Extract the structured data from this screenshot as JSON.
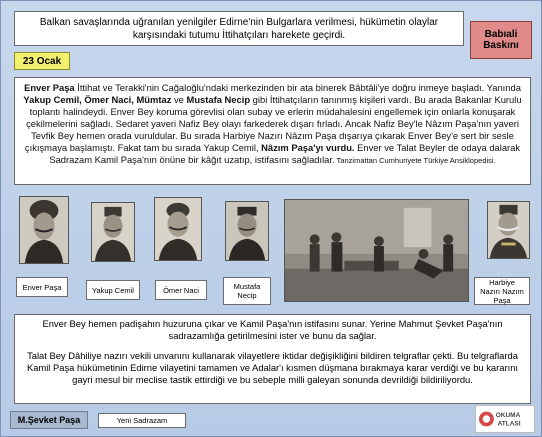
{
  "intro_text": "Balkan savaşlarında uğranılan yenilgiler Edirne'nin Bulgarlara verilmesi, hükümetin olaylar karşısındaki tutumu İttihatçıları harekete geçirdi.",
  "side_button": "Babıali Baskını",
  "date_label": "23 Ocak",
  "story": {
    "s1_bold": "Enver Paşa",
    "s1_a": " İttihat ve Terakki'nin Cağaloğlu'ndaki merkezinden bir ata binerek Bâbtâli'ye doğru inmeye başladı. Yanında ",
    "s1_names": "Yakup Cemil, Ömer Naci, Mümtaz",
    "s1_ve": " ve ",
    "s1_mustafa": "Mustafa Necip",
    "s1_b": " gibi İttihatçıların tanınmış kişileri vardı. Bu arada Bakanlar Kurulu toplantı halindeydi. Enver Bey koruma görevlisi olan subay ve erlerin müdahalesini engellemek için onlarla konuşarak çekilmelerini sağladı. Sedaret yaveri Nafiz Bey olayı farkederek dışarı fırladı. Ancak Nafiz Bey'le Nâzım Paşa'nın yaveri Tevfik Bey hemen orada vuruldular. Bu sırada Harbiye Nazırı Nâzım Paşa dışarıya çıkarak Enver Bey'e sert bir sesle çıkışmaya başlamıştı. Fakat tam bu sırada Yakup Cemil, ",
    "s1_vurdu": "Nâzım Paşa'yı vurdu.",
    "s1_c": " Enver ve Talat Beyler de odaya dalarak Sadrazam Kamil Paşa'nın önüne bir kâğıt uzatıp, istifasını sağladılar.",
    "source": " Tanzimattan Cumhuriyete Türkiye Ansiklopedisi."
  },
  "captions": {
    "enver": "Enver Paşa",
    "yakup": "Yakup Cemil",
    "omer": "Ömer Naci",
    "mustafa": "Mustafa Necip",
    "nazim": "Harbiye Nazırı Nazım Paşa"
  },
  "bottom": {
    "p1": "Enver Bey hemen padişahın huzuruna çıkar ve Kamil Paşa'nın istifasını sunar. Yerine Mahmut Şevket Paşa'nın sadrazamlığa getirilmesini ister ve bunu da sağlar.",
    "p2": "Talat Bey Dâhiliye nazırı vekili unvanını kullanarak vilayetlere iktidar değişikliğini bildiren telgraflar çekti. Bu telgraflarda Kamil Paşa hükümetinin Edirne vilayetini tamamen ve Adalar'ı kısmen düşmana bırakmaya karar verdiği ve bu kararını gayri mesul bir meclise tastik ettirdiği ve bu sebeple milli galeyan sonunda devrildiği bildiriliyordu."
  },
  "tab_sevket": "M.Şevket Paşa",
  "tab_yeni": "Yeni Sadrazam",
  "logo_text": {
    "top": "OKUMA",
    "bottom": "ATLASI"
  },
  "colors": {
    "background": "#c2d3ea",
    "button_red": "#e08a8a",
    "date_yellow": "#f3f070"
  }
}
